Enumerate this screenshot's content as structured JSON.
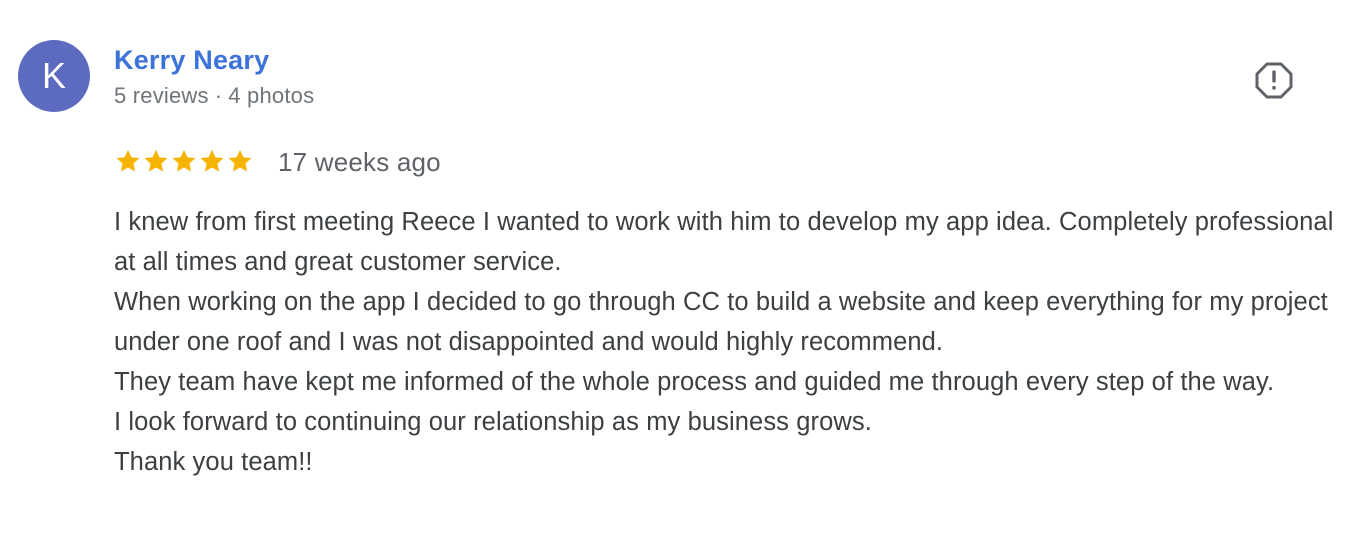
{
  "review": {
    "avatar_letter": "K",
    "avatar_color": "#5c6bc0",
    "reviewer_name": "Kerry Neary",
    "reviews_count": "5 reviews",
    "separator": "·",
    "photos_count": "4 photos",
    "rating": 5,
    "star_color": "#f4b400",
    "time_ago": "17 weeks ago",
    "report_icon": "report-flag-icon",
    "paragraphs": [
      "I knew from first meeting Reece I wanted to work with him to develop my app idea. Completely professional at all times and great customer service.",
      "When working on the app I decided to go through CC to build a website and keep everything for my project under one roof and I was not disappointed and would highly recommend.",
      "They team have kept me informed of the whole process and guided me through every step of the way.",
      "I look forward to continuing our relationship as my business grows.",
      "Thank you team!!"
    ]
  }
}
